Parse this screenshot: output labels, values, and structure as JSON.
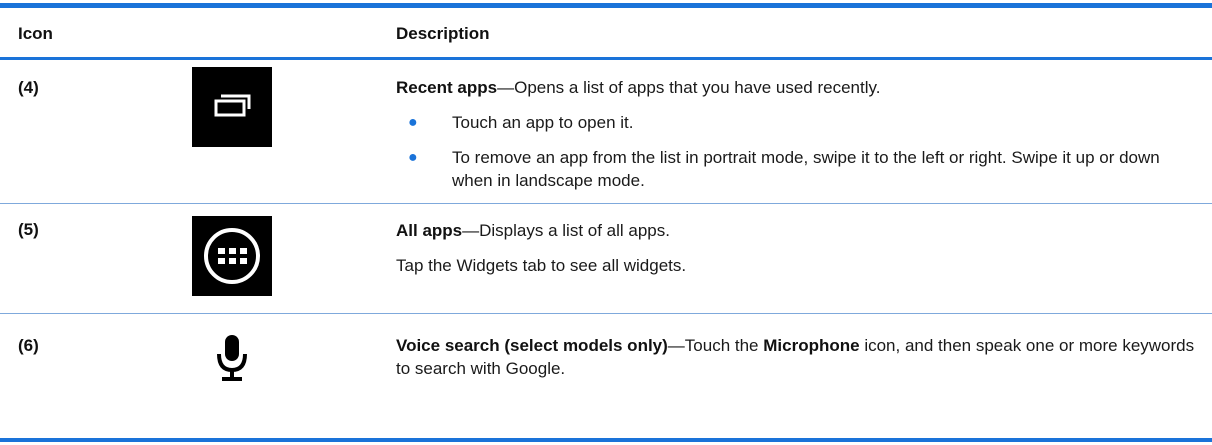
{
  "header": {
    "icon_label": "Icon",
    "description_label": "Description"
  },
  "rows": [
    {
      "number": "(4)",
      "icon": "recent-apps-icon",
      "title": "Recent apps",
      "text": "—Opens a list of apps that you have used recently.",
      "bullets": [
        "Touch an app to open it.",
        "To remove an app from the list in portrait mode, swipe it to the left or right. Swipe it up or down when in landscape mode."
      ]
    },
    {
      "number": "(5)",
      "icon": "all-apps-icon",
      "title": "All apps",
      "text": "—Displays a list of all apps.",
      "extra": "Tap the Widgets tab to see all widgets."
    },
    {
      "number": "(6)",
      "icon": "microphone-icon",
      "title": "Voice search (select models only)",
      "text_pre": "—Touch the ",
      "text_bold": "Microphone",
      "text_post": " icon, and then speak one or more keywords to search with Google."
    }
  ],
  "colors": {
    "rule": "#1a73d9",
    "bullet": "#1a73d9"
  }
}
